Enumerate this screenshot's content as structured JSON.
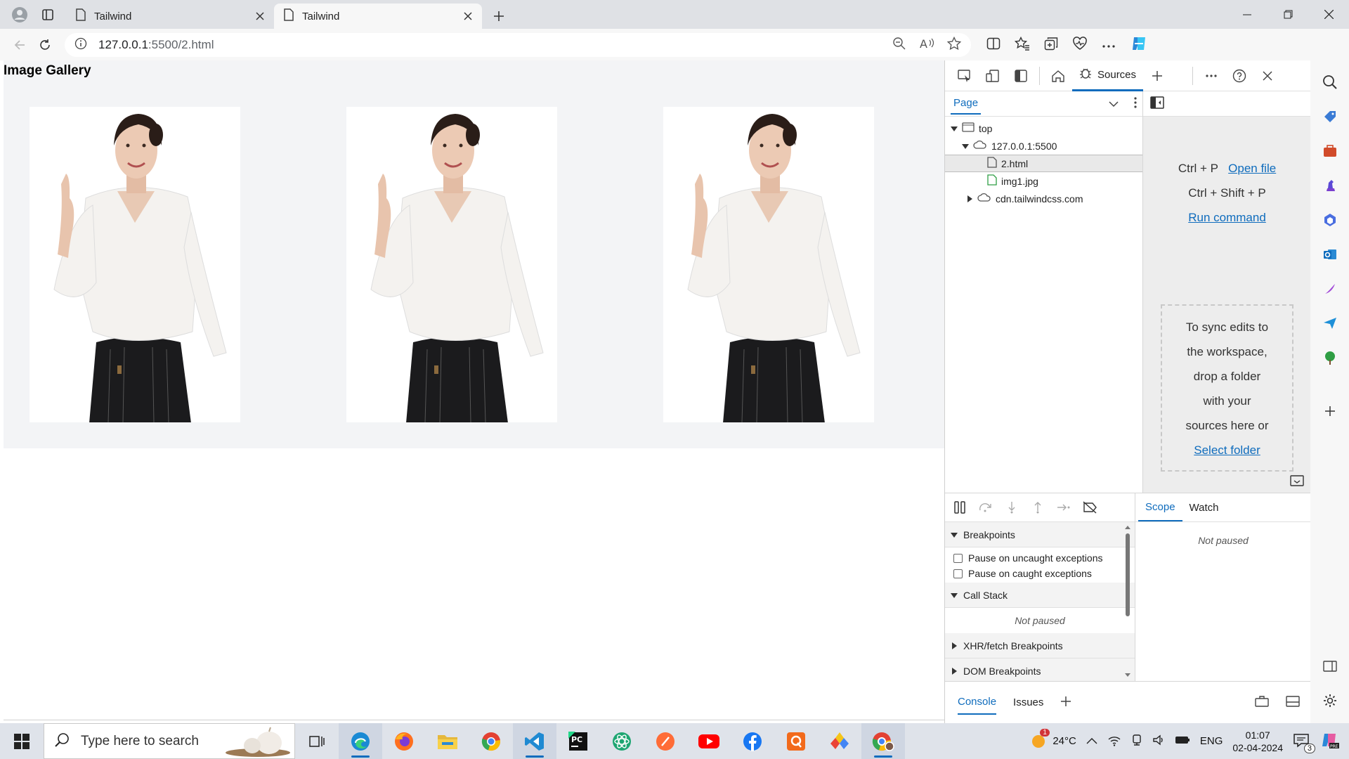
{
  "browser": {
    "tabs": [
      {
        "title": "Tailwind",
        "active": false
      },
      {
        "title": "Tailwind",
        "active": true
      }
    ],
    "address": {
      "host": "127.0.0.1",
      "path": ":5500/2.html"
    }
  },
  "page": {
    "title": "Image Gallery",
    "images": [
      {
        "alt": "woman pointing up"
      },
      {
        "alt": "woman pointing up"
      },
      {
        "alt": "woman pointing up"
      }
    ]
  },
  "devtools": {
    "active_tool": "Sources",
    "navigator": {
      "tab": "Page",
      "tree": [
        {
          "label": "top",
          "level": 0,
          "expanded": true,
          "kind": "frame"
        },
        {
          "label": "127.0.0.1:5500",
          "level": 1,
          "expanded": true,
          "kind": "cloud"
        },
        {
          "label": "2.html",
          "level": 2,
          "kind": "file",
          "selected": true
        },
        {
          "label": "img1.jpg",
          "level": 2,
          "kind": "image"
        },
        {
          "label": "cdn.tailwindcss.com",
          "level": 1,
          "expanded": false,
          "kind": "cloud"
        }
      ]
    },
    "editor": {
      "shortcut1": "Ctrl + P",
      "shortcut1_link": "Open file",
      "shortcut2": "Ctrl + Shift + P",
      "shortcut2_link": "Run command",
      "drop_text": [
        "To sync edits to",
        "the workspace,",
        "drop a folder",
        "with your",
        "sources here or"
      ],
      "drop_link": "Select folder"
    },
    "debugger": {
      "breakpoints_label": "Breakpoints",
      "uncaught": "Pause on uncaught exceptions",
      "caught": "Pause on caught exceptions",
      "call_stack": "Call Stack",
      "call_stack_state": "Not paused",
      "xhr": "XHR/fetch Breakpoints",
      "dom": "DOM Breakpoints"
    },
    "scope": {
      "tabs": [
        "Scope",
        "Watch"
      ],
      "state": "Not paused"
    },
    "drawer": {
      "tabs": [
        "Console",
        "Issues"
      ]
    }
  },
  "taskbar": {
    "search_placeholder": "Type here to search",
    "weather": "24°C",
    "language": "ENG",
    "time": "01:07",
    "date": "02-04-2024",
    "notification_count": "3",
    "weather_badge": "1"
  },
  "colors": {
    "accent": "#0f6cbd",
    "gallery_bg": "#f3f4f6"
  }
}
